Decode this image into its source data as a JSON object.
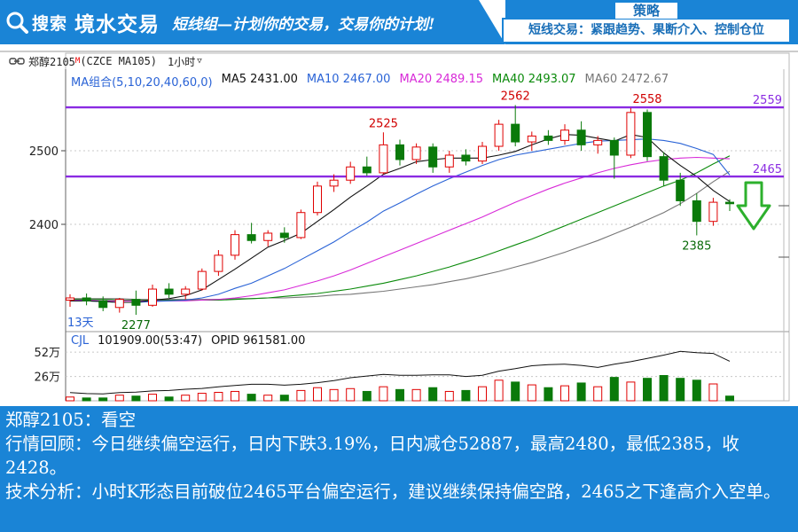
{
  "header": {
    "brand_search": "搜索",
    "brand_name": "境水交易",
    "brand_slogan": "短线组—计划你的交易，交易你的计划!",
    "strategy_tag": "策略",
    "strategy_text": "短线交易：紧跟趋势、果断介入、控制仓位"
  },
  "toolbar": {
    "symbol": "郑醇2105",
    "symbol_mark": "M",
    "exchange": "(CZCE MA105)",
    "period": "1小时"
  },
  "indicators": {
    "ma_group": "MA组合(5,10,20,40,60,0)",
    "ma5": "MA5 2431.00",
    "ma10": "MA10 2467.00",
    "ma20": "MA20 2489.15",
    "ma40": "MA40 2493.07",
    "ma60": "MA60 2472.67",
    "vol_name": "CJL",
    "vol_value": "101909.00(53:47)",
    "opid": "OPID 961581.00"
  },
  "colors": {
    "up": "#e00000",
    "down": "#0a7a0a",
    "ma5": "#111111",
    "ma10": "#2a63d6",
    "ma20": "#d82ad8",
    "ma40": "#0a8a0a",
    "ma60": "#777777",
    "level_line": "#8a2be2",
    "arrow": "#2db02d",
    "banner": "#1a84d6"
  },
  "chart_data": {
    "type": "candlestick",
    "y_ticks": [
      "2500",
      "2400"
    ],
    "vol_ticks": [
      "52万",
      "26万"
    ],
    "levels": [
      {
        "value": 2559,
        "label": "2559"
      },
      {
        "value": 2465,
        "label": "2465"
      }
    ],
    "annotations": [
      {
        "text": "2525",
        "value": 2525,
        "bar": 19
      },
      {
        "text": "2562",
        "value": 2562,
        "bar": 27
      },
      {
        "text": "2558",
        "value": 2558,
        "bar": 35
      },
      {
        "text": "2385",
        "value": 2385,
        "bar": 38
      },
      {
        "text": "2277",
        "value": 2277,
        "bar": 4
      }
    ],
    "days_label": "13天",
    "candles": [
      {
        "o": 2297,
        "h": 2305,
        "l": 2288,
        "c": 2300
      },
      {
        "o": 2300,
        "h": 2306,
        "l": 2290,
        "c": 2296
      },
      {
        "o": 2296,
        "h": 2302,
        "l": 2282,
        "c": 2287
      },
      {
        "o": 2287,
        "h": 2300,
        "l": 2280,
        "c": 2298
      },
      {
        "o": 2298,
        "h": 2310,
        "l": 2277,
        "c": 2290
      },
      {
        "o": 2290,
        "h": 2318,
        "l": 2288,
        "c": 2312
      },
      {
        "o": 2312,
        "h": 2320,
        "l": 2300,
        "c": 2305
      },
      {
        "o": 2305,
        "h": 2316,
        "l": 2298,
        "c": 2312
      },
      {
        "o": 2312,
        "h": 2340,
        "l": 2310,
        "c": 2336
      },
      {
        "o": 2336,
        "h": 2365,
        "l": 2330,
        "c": 2358
      },
      {
        "o": 2358,
        "h": 2392,
        "l": 2352,
        "c": 2386
      },
      {
        "o": 2386,
        "h": 2402,
        "l": 2374,
        "c": 2378
      },
      {
        "o": 2378,
        "h": 2392,
        "l": 2370,
        "c": 2388
      },
      {
        "o": 2388,
        "h": 2396,
        "l": 2375,
        "c": 2382
      },
      {
        "o": 2382,
        "h": 2420,
        "l": 2380,
        "c": 2416
      },
      {
        "o": 2416,
        "h": 2458,
        "l": 2412,
        "c": 2452
      },
      {
        "o": 2452,
        "h": 2468,
        "l": 2444,
        "c": 2460
      },
      {
        "o": 2460,
        "h": 2485,
        "l": 2455,
        "c": 2478
      },
      {
        "o": 2478,
        "h": 2492,
        "l": 2466,
        "c": 2470
      },
      {
        "o": 2470,
        "h": 2525,
        "l": 2468,
        "c": 2508
      },
      {
        "o": 2508,
        "h": 2515,
        "l": 2480,
        "c": 2488
      },
      {
        "o": 2488,
        "h": 2510,
        "l": 2482,
        "c": 2505
      },
      {
        "o": 2505,
        "h": 2510,
        "l": 2470,
        "c": 2478
      },
      {
        "o": 2478,
        "h": 2500,
        "l": 2470,
        "c": 2494
      },
      {
        "o": 2494,
        "h": 2502,
        "l": 2480,
        "c": 2486
      },
      {
        "o": 2486,
        "h": 2512,
        "l": 2482,
        "c": 2506
      },
      {
        "o": 2506,
        "h": 2542,
        "l": 2500,
        "c": 2536
      },
      {
        "o": 2536,
        "h": 2562,
        "l": 2506,
        "c": 2512
      },
      {
        "o": 2512,
        "h": 2526,
        "l": 2500,
        "c": 2520
      },
      {
        "o": 2520,
        "h": 2528,
        "l": 2508,
        "c": 2514
      },
      {
        "o": 2514,
        "h": 2536,
        "l": 2508,
        "c": 2528
      },
      {
        "o": 2528,
        "h": 2540,
        "l": 2500,
        "c": 2508
      },
      {
        "o": 2508,
        "h": 2520,
        "l": 2496,
        "c": 2514
      },
      {
        "o": 2514,
        "h": 2518,
        "l": 2462,
        "c": 2494
      },
      {
        "o": 2494,
        "h": 2558,
        "l": 2490,
        "c": 2552
      },
      {
        "o": 2552,
        "h": 2556,
        "l": 2486,
        "c": 2492
      },
      {
        "o": 2492,
        "h": 2498,
        "l": 2452,
        "c": 2460
      },
      {
        "o": 2460,
        "h": 2470,
        "l": 2425,
        "c": 2432
      },
      {
        "o": 2432,
        "h": 2442,
        "l": 2385,
        "c": 2404
      },
      {
        "o": 2404,
        "h": 2436,
        "l": 2398,
        "c": 2430
      },
      {
        "o": 2430,
        "h": 2434,
        "l": 2418,
        "c": 2428
      }
    ],
    "volume_wan": [
      4,
      3,
      3,
      6,
      5,
      7,
      4,
      6,
      8,
      9,
      10,
      7,
      6,
      6,
      11,
      14,
      12,
      13,
      10,
      15,
      12,
      12,
      14,
      10,
      11,
      15,
      22,
      20,
      17,
      14,
      16,
      19,
      15,
      25,
      20,
      24,
      27,
      24,
      22,
      18,
      5
    ],
    "ma_lines": {
      "ma5": [
        2296,
        2296,
        2295,
        2294,
        2294,
        2297,
        2299,
        2303,
        2311,
        2325,
        2339,
        2354,
        2369,
        2378,
        2388,
        2404,
        2420,
        2437,
        2452,
        2468,
        2476,
        2485,
        2488,
        2490,
        2490,
        2490,
        2494,
        2499,
        2508,
        2516,
        2522,
        2521,
        2517,
        2513,
        2522,
        2518,
        2497,
        2480,
        2465,
        2446,
        2431
      ],
      "ma10": [
        2296,
        2296,
        2295,
        2294,
        2294,
        2295,
        2296,
        2297,
        2300,
        2305,
        2313,
        2320,
        2330,
        2340,
        2352,
        2364,
        2376,
        2390,
        2403,
        2418,
        2429,
        2441,
        2452,
        2462,
        2471,
        2480,
        2488,
        2494,
        2498,
        2502,
        2506,
        2510,
        2513,
        2514,
        2515,
        2516,
        2514,
        2510,
        2503,
        2495,
        2467
      ],
      "ma20": [
        2297,
        2297,
        2296,
        2296,
        2296,
        2296,
        2296,
        2296,
        2297,
        2298,
        2300,
        2303,
        2307,
        2311,
        2317,
        2323,
        2330,
        2338,
        2347,
        2356,
        2365,
        2374,
        2383,
        2392,
        2401,
        2410,
        2420,
        2430,
        2439,
        2448,
        2456,
        2463,
        2470,
        2476,
        2481,
        2485,
        2488,
        2490,
        2491,
        2490,
        2489
      ],
      "ma40": [
        2298,
        2298,
        2298,
        2297,
        2297,
        2297,
        2297,
        2297,
        2297,
        2297,
        2298,
        2299,
        2300,
        2302,
        2304,
        2306,
        2309,
        2312,
        2316,
        2320,
        2325,
        2330,
        2336,
        2342,
        2349,
        2356,
        2364,
        2372,
        2380,
        2389,
        2398,
        2407,
        2416,
        2425,
        2434,
        2443,
        2452,
        2460,
        2470,
        2482,
        2493
      ],
      "ma60": [
        2299,
        2299,
        2299,
        2299,
        2298,
        2298,
        2298,
        2298,
        2298,
        2298,
        2299,
        2299,
        2300,
        2300,
        2301,
        2302,
        2304,
        2305,
        2307,
        2309,
        2312,
        2315,
        2318,
        2322,
        2326,
        2331,
        2336,
        2342,
        2348,
        2355,
        2362,
        2370,
        2378,
        2387,
        2396,
        2406,
        2416,
        2428,
        2442,
        2458,
        2472
      ]
    }
  },
  "analysis": {
    "title": "郑醇2105：看空",
    "review": "行情回顾：今日继续偏空运行，日内下跌3.19%，日内减仓52887，最高2480，最低2385，收2428。",
    "technical": "技术分析：小时K形态目前破位2465平台偏空运行，建议继续保持偏空路，2465之下逢高介入空单。"
  }
}
